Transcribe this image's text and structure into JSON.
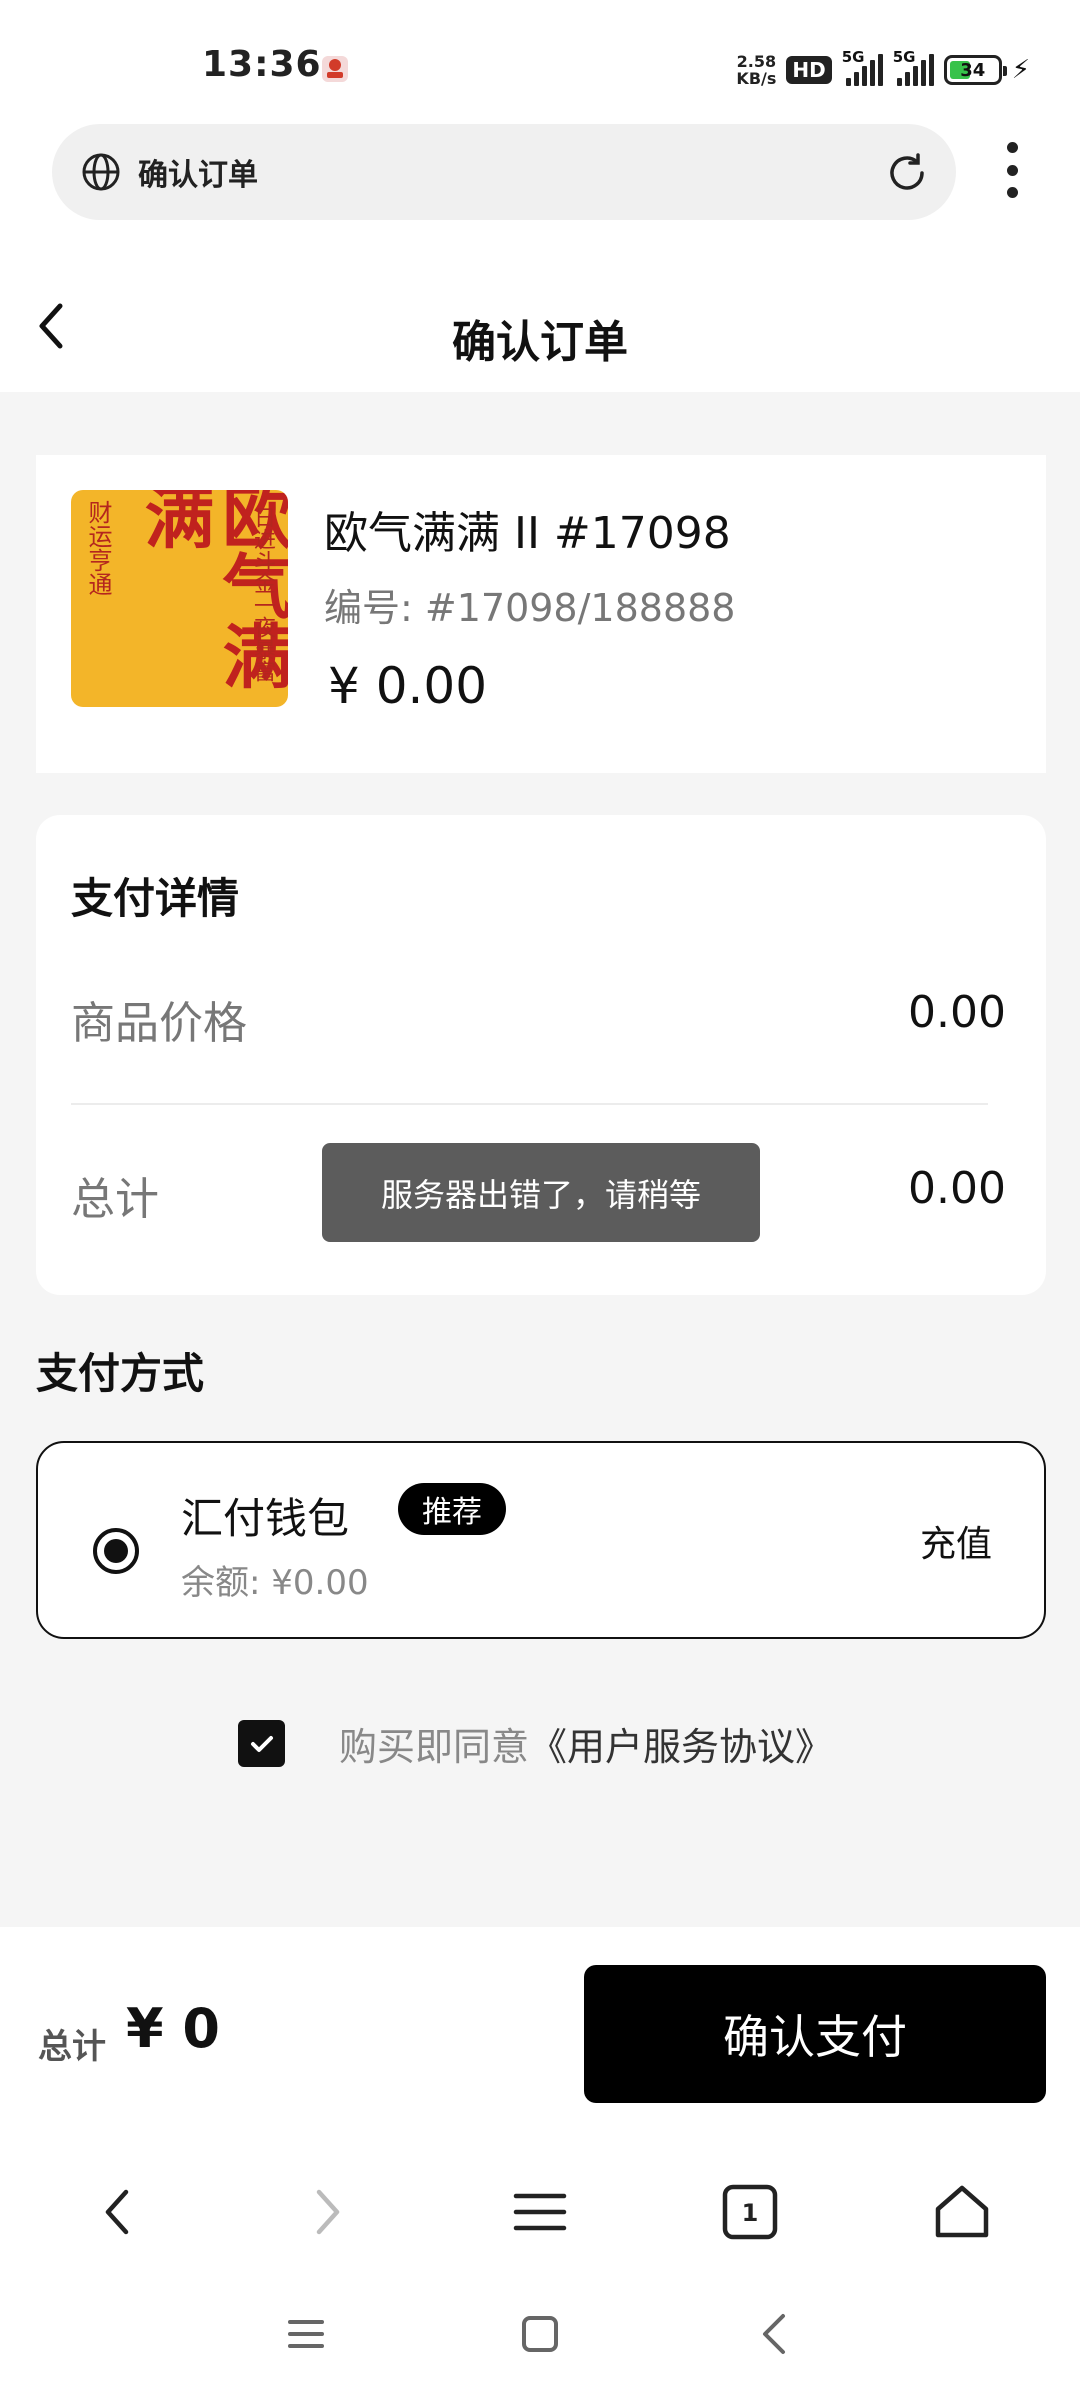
{
  "status_bar": {
    "time": "13:36",
    "net_speed_value": "2.58",
    "net_speed_unit": "KB/s",
    "hd_label": "HD",
    "sim1_label": "5G",
    "sim2_label": "5G",
    "battery": "34",
    "battery_color": "#37c24a"
  },
  "browser": {
    "url_title": "确认订单",
    "tab_count": "1"
  },
  "page": {
    "title": "确认订单"
  },
  "product": {
    "name": "欧气满满 II  #17098",
    "serial": "编号: #17098/188888",
    "price": "¥ 0.00",
    "image_text_main": "欧气满满",
    "image_text_left": "财运亨通",
    "image_text_right": "日进斗金一夜暴富"
  },
  "payment_details": {
    "title": "支付详情",
    "rows": [
      {
        "label": "商品价格",
        "value": "0.00"
      },
      {
        "label": "总计",
        "value": "0.00"
      }
    ]
  },
  "toast": {
    "message": "服务器出错了，请稍等"
  },
  "payment_method": {
    "title": "支付方式",
    "wallet_name": "汇付钱包",
    "badge": "推荐",
    "balance": "余额: ¥0.00",
    "recharge": "充值",
    "selected": true
  },
  "agreement": {
    "prefix": "购买即同意",
    "link": "《用户服务协议》",
    "checked": true
  },
  "footer": {
    "total_label": "总计",
    "total_value": "¥ 0",
    "confirm_label": "确认支付"
  }
}
